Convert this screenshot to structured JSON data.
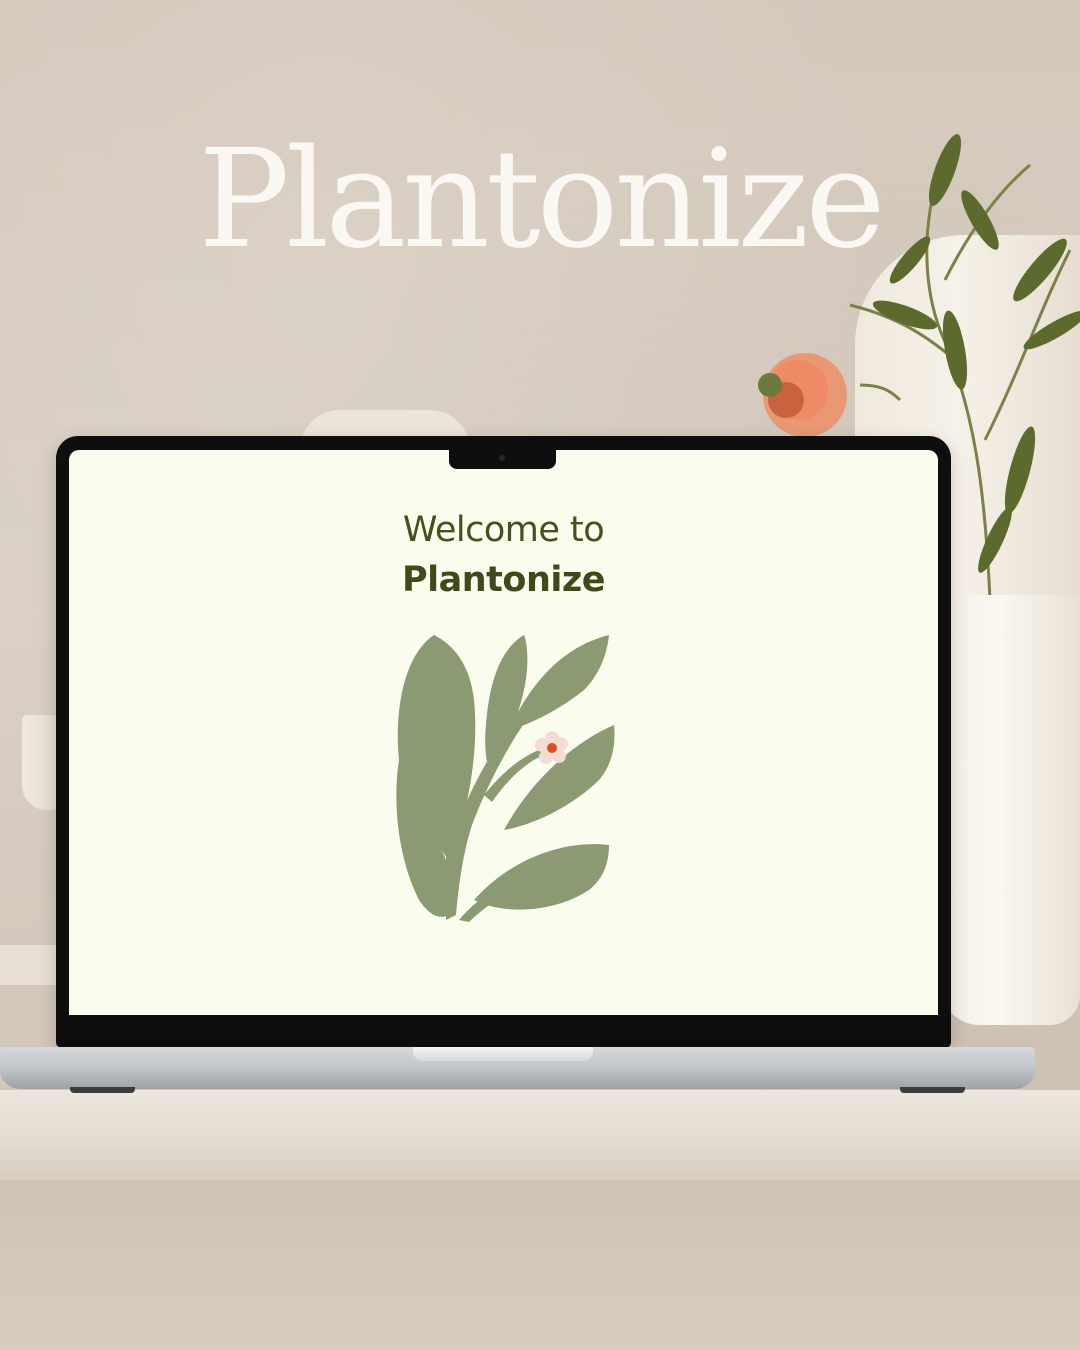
{
  "brand": {
    "title": "Plantonize"
  },
  "screen": {
    "welcome_line": "Welcome to",
    "welcome_brand": "Plantonize"
  },
  "colors": {
    "screen_background": "#fafdee",
    "text_dark_green": "#3e4a1c",
    "leaf_sage": "#8c9a74",
    "flower_dot": "#d94f1f"
  },
  "icons": {
    "illustration": "leaf-flower-illustration"
  }
}
